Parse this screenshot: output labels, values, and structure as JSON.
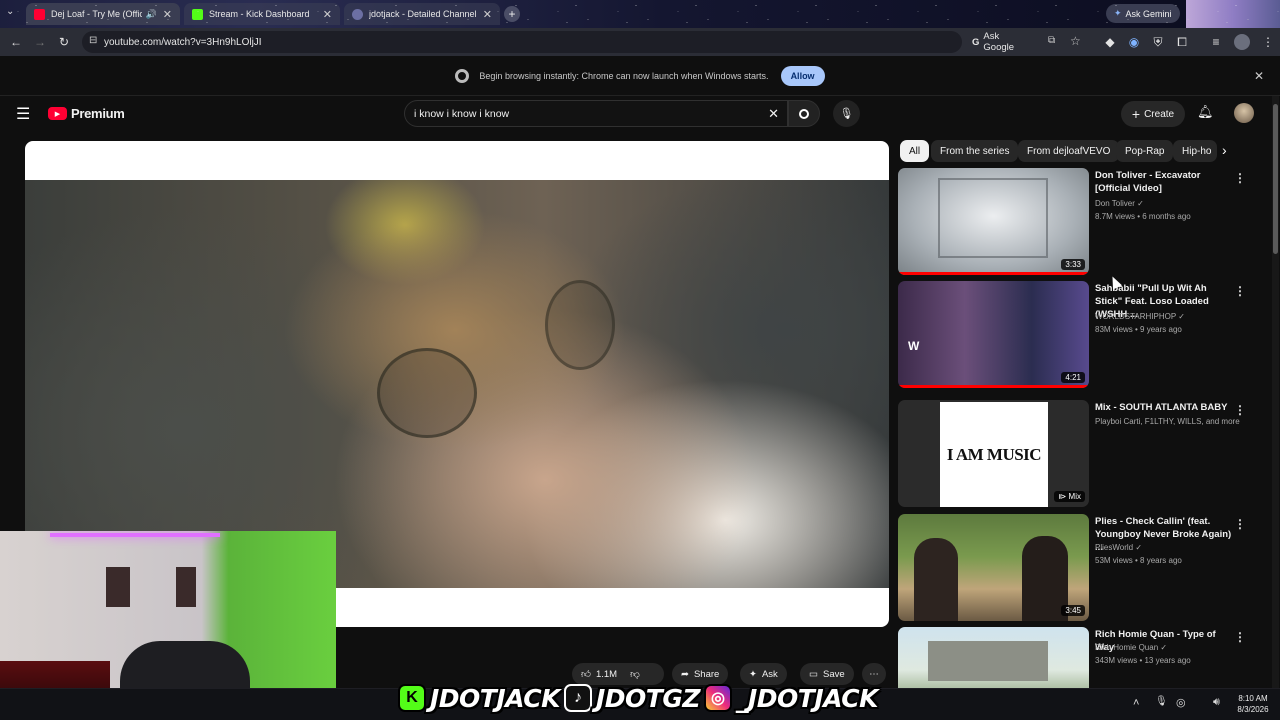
{
  "browser": {
    "tabs": [
      {
        "title": "Dej Loaf - Try Me (Official",
        "active": true
      },
      {
        "title": "Stream - Kick Dashboard",
        "active": false
      },
      {
        "title": "jdotjack - Detailed Channel Vie",
        "active": false
      }
    ],
    "ask_gemini_label": "Ask Gemini",
    "url": "youtube.com/watch?v=3Hn9hLOljJI",
    "ask_google_label": "Ask Google"
  },
  "infobar": {
    "message": "Begin browsing instantly: Chrome can now launch when Windows starts.",
    "allow_label": "Allow"
  },
  "youtube": {
    "logo_text": "Premium",
    "search_query": "i know i know i know",
    "create_label": "Create"
  },
  "chips": [
    "All",
    "From the series",
    "From dejloafVEVO",
    "Pop-Rap",
    "Hip-ho"
  ],
  "recommendations": [
    {
      "title": "Don Toliver - Excavator [Official Video]",
      "channel": "Don Toliver",
      "verified": true,
      "meta": "8.7M views • 6 months ago",
      "duration": "3:33",
      "progress": 1.0
    },
    {
      "title": "Sahbabii \"Pull Up Wit Ah Stick\" Feat. Loso Loaded (WSHH ...",
      "channel": "WORLDSTARHIPHOP",
      "verified": true,
      "meta": "83M views • 9 years ago",
      "duration": "4:21",
      "progress": 1.0
    },
    {
      "title": "Mix - SOUTH ATLANTA BABY",
      "channel": "Playboi Carti, F1LTHY, WILLS, and more",
      "verified": false,
      "meta": "",
      "duration": "Mix",
      "thumb_text": "I AM MUSIC",
      "progress": 0
    },
    {
      "title": "Plies - Check Callin' (feat. Youngboy Never Broke Again) ...",
      "channel": "PliesWorld",
      "verified": true,
      "meta": "53M views • 8 years ago",
      "duration": "3:45",
      "progress": 0
    },
    {
      "title": "Rich Homie Quan - Type of Way",
      "channel": "Rich Homie Quan",
      "verified": true,
      "meta": "343M views • 13 years ago",
      "duration": "",
      "progress": 0
    }
  ],
  "actions": {
    "like_count": "1.1M",
    "share_label": "Share",
    "ask_label": "Ask",
    "save_label": "Save"
  },
  "overlay": {
    "kick_handle": "JDOTJACK",
    "tiktok_handle": "JDOTGZ",
    "instagram_handle": "_JDOTJACK"
  },
  "taskbar": {
    "time": "8:10 AM",
    "date": "8/3/2026"
  },
  "colors": {
    "youtube_red": "#ff0033",
    "kick_green": "#53fc18",
    "allow_button": "#a8c7fa"
  }
}
